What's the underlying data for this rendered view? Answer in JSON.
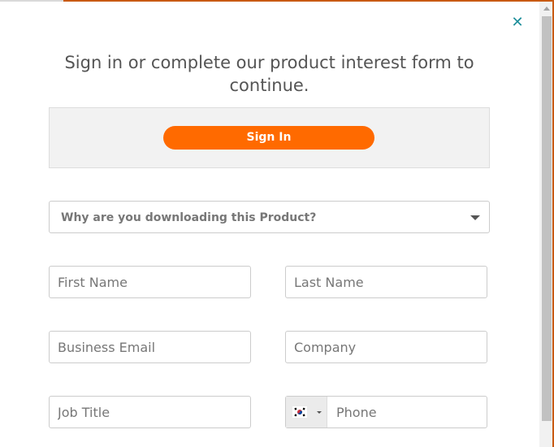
{
  "modal": {
    "close_icon": "close-icon",
    "title": "Sign in or complete our product interest form to continue."
  },
  "signin": {
    "button_label": "Sign In",
    "accent_color": "#ff6a00"
  },
  "form": {
    "reason_select": {
      "label": "Why are you downloading this Product?"
    },
    "first_name": {
      "placeholder": "First Name"
    },
    "last_name": {
      "placeholder": "Last Name"
    },
    "business_email": {
      "placeholder": "Business Email"
    },
    "company": {
      "placeholder": "Company"
    },
    "job_title": {
      "placeholder": "Job Title"
    },
    "phone": {
      "placeholder": "Phone",
      "country_flag": "south-korea-flag-icon"
    }
  },
  "colors": {
    "close_icon": "#1e8f9b",
    "title_text": "#555555"
  }
}
